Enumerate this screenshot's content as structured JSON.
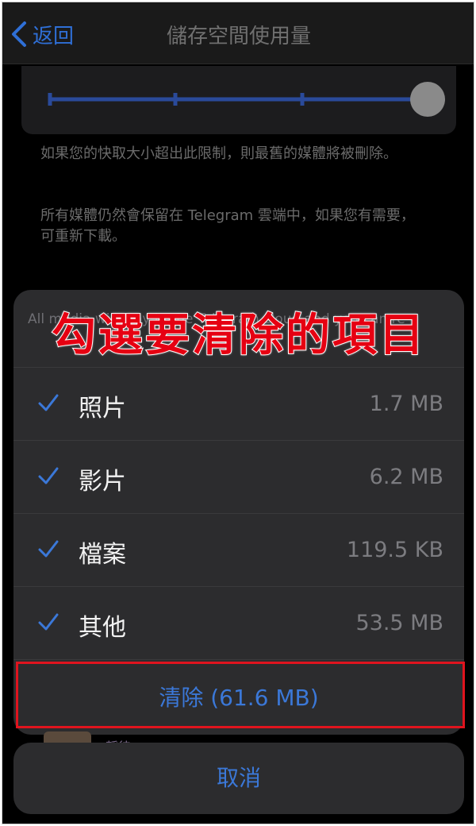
{
  "nav": {
    "back_label": "返回",
    "title": "儲存空間使用量"
  },
  "slider": {
    "level": 1.0
  },
  "notes": [
    "如果您的快取大小超出此限制，則最舊的媒體將被刪除。",
    "所有媒體仍然會保留在 Telegram 雲端中，如果您有需要，可重新下載。"
  ],
  "sheet": {
    "header_text": "All media will stay in the Telegram cloud and you can re-",
    "overlay_title": "勾選要清除的項目",
    "items": [
      {
        "label": "照片",
        "size": "1.7 MB",
        "checked": true
      },
      {
        "label": "影片",
        "size": "6.2 MB",
        "checked": true
      },
      {
        "label": "檔案",
        "size": "119.5 KB",
        "checked": true
      },
      {
        "label": "其他",
        "size": "53.5 MB",
        "checked": true
      }
    ],
    "clear_label": "清除 (61.6 MB)",
    "cancel_label": "取消"
  },
  "peek": {
    "text": "靜待"
  },
  "colors": {
    "accent": "#3b78d8",
    "annotation_red": "#e60012",
    "sheet_bg": "#2c2c2e"
  }
}
